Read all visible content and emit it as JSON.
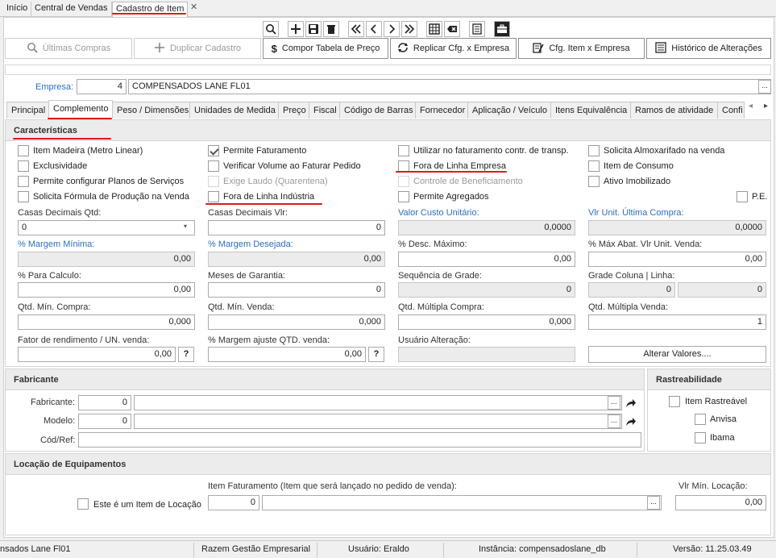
{
  "top_tabs": [
    "Início",
    "Central de Vendas",
    "Cadastro de Item"
  ],
  "close_glyph": "✕",
  "toolbar_icons": [
    "search-icon",
    "add-icon",
    "save-icon",
    "delete-icon",
    "first-icon",
    "prev-icon",
    "next-icon",
    "last-icon",
    "grid-icon",
    "clear-icon",
    "report-icon",
    "toolbox-icon"
  ],
  "actions": {
    "ultimas_compras": "Últimas Compras",
    "duplicar": "Duplicar Cadastro",
    "compor": "Compor Tabela de Preço",
    "replicar": "Replicar Cfg. x Empresa",
    "cfg_item": "Cfg. Item x  Empresa",
    "historico": "Histórico de Alterações"
  },
  "empresa": {
    "label": "Empresa:",
    "code": "4",
    "name": "COMPENSADOS LANE FL01",
    "dots": "..."
  },
  "section_tabs": [
    "Principal",
    "Complemento",
    "Peso / Dimensões",
    "Unidades de Medida",
    "Preço",
    "Fiscal",
    "Código de Barras",
    "Fornecedor",
    "Aplicação / Veículo",
    "Itens Equivalência",
    "Ramos de atividade",
    "Confi"
  ],
  "caracteristicas": {
    "title": "Características",
    "checkboxes": [
      {
        "label": "Item Madeira (Metro Linear)",
        "checked": false,
        "disabled": false
      },
      {
        "label": "Exclusividade",
        "checked": false,
        "disabled": false
      },
      {
        "label": "Permite configurar Planos de Serviços",
        "checked": false,
        "disabled": false
      },
      {
        "label": "Solicita Fórmula de Produção na Venda",
        "checked": false,
        "disabled": false
      },
      {
        "label": "Permite Faturamento",
        "checked": true,
        "disabled": false
      },
      {
        "label": "Verificar Volume ao Faturar Pedido",
        "checked": false,
        "disabled": false
      },
      {
        "label": "Exige Laudo (Quarentena)",
        "checked": false,
        "disabled": true
      },
      {
        "label": "Fora de Linha Indústria",
        "checked": false,
        "disabled": false
      },
      {
        "label": "Utilizar no faturamento contr. de transp.",
        "checked": false,
        "disabled": false
      },
      {
        "label": "Fora de Linha Empresa",
        "checked": false,
        "disabled": false
      },
      {
        "label": "Controle de Beneficiamento",
        "checked": false,
        "disabled": true
      },
      {
        "label": "Permite Agregados",
        "checked": false,
        "disabled": false
      },
      {
        "label": "Solicita Almoxarifado na venda",
        "checked": false,
        "disabled": false
      },
      {
        "label": "Item de Consumo",
        "checked": false,
        "disabled": false
      },
      {
        "label": "Ativo Imobilizado",
        "checked": false,
        "disabled": false
      },
      {
        "label": "P.E.",
        "checked": false,
        "disabled": false
      }
    ],
    "fields": {
      "casas_dec_qtd": {
        "label": "Casas Decimais Qtd:",
        "value": "0"
      },
      "casas_dec_vlr": {
        "label": "Casas Decimais Vlr:",
        "value": "0"
      },
      "valor_custo": {
        "label": "Valor Custo Unitário:",
        "value": "0,0000"
      },
      "vlr_ult_compra": {
        "label": "Vlr Unit. Última Compra:",
        "value": "0,0000"
      },
      "margem_min": {
        "label": "% Margem Mínima:",
        "value": "0,00"
      },
      "margem_des": {
        "label": "% Margem Desejada:",
        "value": "0,00"
      },
      "desc_max": {
        "label": "% Desc. Máximo:",
        "value": "0,00"
      },
      "max_abat": {
        "label": "% Máx Abat. Vlr Unit. Venda:",
        "value": "0,00"
      },
      "para_calculo": {
        "label": "% Para Calculo:",
        "value": "0,00"
      },
      "meses_garantia": {
        "label": "Meses de Garantia:",
        "value": "0"
      },
      "seq_grade": {
        "label": "Sequência de Grade:",
        "value": "0"
      },
      "grade_col": {
        "label": "Grade Coluna | Linha:",
        "value1": "0",
        "value2": "0"
      },
      "qtd_min_compra": {
        "label": "Qtd. Mín. Compra:",
        "value": "0,000"
      },
      "qtd_min_venda": {
        "label": "Qtd. Mín. Venda:",
        "value": "0,000"
      },
      "qtd_mult_compra": {
        "label": "Qtd. Múltipla Compra:",
        "value": "0,000"
      },
      "qtd_mult_venda": {
        "label": "Qtd. Múltipla Venda:",
        "value": "1"
      },
      "fator_rend": {
        "label": "Fator de rendimento / UN. venda:",
        "value": "0,00"
      },
      "margem_ajuste": {
        "label": "% Margem ajuste QTD. venda:",
        "value": "0,00"
      },
      "usuario_alt": {
        "label": "Usuário Alteração:",
        "value": ""
      },
      "alterar_valores": "Alterar Valores....",
      "help": "?"
    }
  },
  "fabricante": {
    "title": "Fabricante",
    "fabricante_label": "Fabricante:",
    "fabricante_code": "0",
    "modelo_label": "Modelo:",
    "modelo_code": "0",
    "codref_label": "Cód/Ref:",
    "dots": "..."
  },
  "rastreabilidade": {
    "title": "Rastreabilidade",
    "items": [
      "Item Rastreável",
      "Anvisa",
      "Ibama"
    ]
  },
  "locacao": {
    "title": "Locação de Equipamentos",
    "item_fat_label": "Item Faturamento (Item que será lançado no pedido de venda):",
    "item_fat_code": "0",
    "vlr_min_label": "Vlr Mín. Locação:",
    "vlr_min_value": "0,00",
    "checkbox_label": "Este é um Item de Locação",
    "dots": "..."
  },
  "status": {
    "empresa": "nsados Lane Fl01",
    "sistema": "Razem Gestão Empresarial",
    "usuario": "Usuário: Eraldo",
    "instancia": "Instância: compensadoslane_db",
    "versao": "Versão: 11.25.03.49"
  },
  "colors": {
    "accent_blue": "#2a6fc2",
    "highlight_red": "#d81b20",
    "panel_header": "#ececec"
  }
}
